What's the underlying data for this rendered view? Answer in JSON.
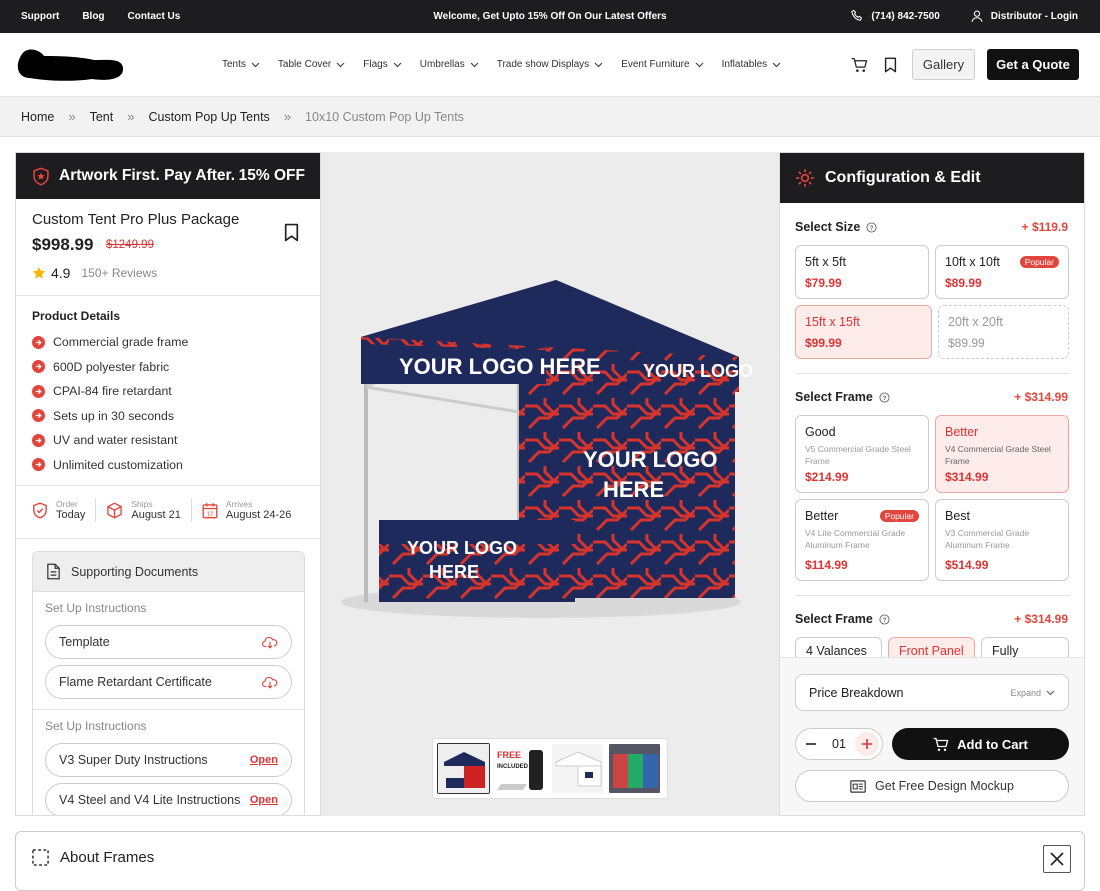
{
  "topbar": {
    "links": [
      "Support",
      "Blog",
      "Contact Us"
    ],
    "welcome": "Welcome, Get Upto 15% Off On Our Latest Offers",
    "phone": "(714) 842-7500",
    "login": "Distributor - Login"
  },
  "nav": {
    "items": [
      "Tents",
      "Table Cover",
      "Flags",
      "Umbrellas",
      "Trade show Displays",
      "Event Furniture",
      "Inflatables"
    ],
    "gallery": "Gallery",
    "quote": "Get a Quote"
  },
  "breadcrumb": [
    "Home",
    "Tent",
    "Custom Pop Up Tents",
    "10x10 Custom Pop Up Tents"
  ],
  "promo": {
    "left": "Artwork First. Pay After.",
    "right": "15% OFF"
  },
  "product": {
    "title": "Custom Tent Pro Plus Package",
    "price": "$998.99",
    "old_price": "$1249.99",
    "rating": "4.9",
    "reviews": "150+ Reviews",
    "details_heading": "Product Details",
    "details": [
      "Commercial grade frame",
      "600D polyester fabric",
      "CPAI-84 fire retardant",
      "Sets up in 30 seconds",
      "UV and water resistant",
      "Unlimited customization"
    ]
  },
  "shipping": [
    {
      "label": "Order",
      "value": "Today"
    },
    {
      "label": "Ships",
      "value": "August 21"
    },
    {
      "label": "Arrives",
      "value": "August 24-26"
    }
  ],
  "documents": {
    "heading": "Supporting Documents",
    "groups": [
      {
        "title": "Set Up Instructions",
        "items": [
          {
            "name": "Template",
            "action": ""
          },
          {
            "name": "Flame Retardant Certificate",
            "action": ""
          }
        ]
      },
      {
        "title": "Set Up Instructions",
        "items": [
          {
            "name": "V3 Super Duty Instructions",
            "action": "Open"
          },
          {
            "name": "V4 Steel and V4 Lite Instructions",
            "action": "Open"
          }
        ]
      }
    ]
  },
  "image": {
    "logo_text": "YOUR LOGO HERE",
    "logo_line1": "YOUR LOGO",
    "logo_line2": "HERE",
    "thumb_free": "FREE",
    "thumb_included": "INCLUDED"
  },
  "config": {
    "heading": "Configuration & Edit",
    "size": {
      "label": "Select Size",
      "price": "+ $119.9",
      "options": [
        {
          "name": "5ft x 5ft",
          "price": "$79.99",
          "badge": ""
        },
        {
          "name": "10ft x 10ft",
          "price": "$89.99",
          "badge": "Popular"
        },
        {
          "name": "15ft x 15ft",
          "price": "$99.99",
          "badge": ""
        },
        {
          "name": "20ft x 20ft",
          "price": "$89.99",
          "badge": ""
        }
      ]
    },
    "frame": {
      "label": "Select Frame",
      "price": "+ $314.99",
      "options": [
        {
          "name": "Good",
          "desc": "V5 Commercial Grade Steel Frame",
          "price": "$214.99",
          "badge": ""
        },
        {
          "name": "Better",
          "desc": "V4 Commercial Grade Steel Frame",
          "price": "$314.99",
          "badge": ""
        },
        {
          "name": "Better",
          "desc": "V4 Lite Commercial Grade Aluminum Frame",
          "price": "$114.99",
          "badge": "Popular"
        },
        {
          "name": "Best",
          "desc": "V3 Commercial Grade Aluminum Frame",
          "price": "$514.99",
          "badge": ""
        }
      ]
    },
    "frame2": {
      "label": "Select Frame",
      "price": "+ $314.99",
      "options": [
        "4 Valances",
        "Front Panel",
        "Fully"
      ]
    },
    "price_breakdown": "Price Breakdown",
    "expand": "Expand",
    "qty": "01",
    "add_to_cart": "Add to Cart",
    "mockup": "Get Free Design Mockup"
  },
  "about": {
    "title": "About Frames"
  },
  "colors": {
    "accent": "#e2453c",
    "dark": "#1d1d1f",
    "navy": "#1f2a5c"
  }
}
